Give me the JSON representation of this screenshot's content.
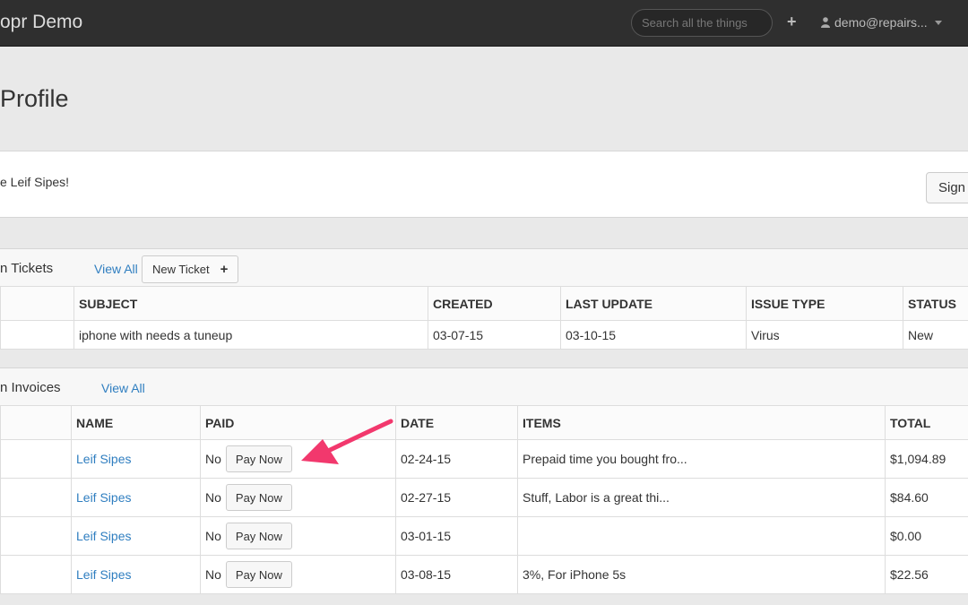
{
  "nav": {
    "brand": "opr Demo",
    "search_placeholder": "Search all the things",
    "add_icon": "plus-icon",
    "user_label": "demo@repairs...",
    "user_icon": "user-icon"
  },
  "page": {
    "title": "Profile",
    "welcome": "e Leif Sipes!",
    "sign_button": "Sign"
  },
  "tickets": {
    "title": "n Tickets",
    "view_all": "View All",
    "new_ticket": "New Ticket",
    "new_ticket_icon": "plus-icon",
    "columns": [
      "SUBJECT",
      "CREATED",
      "LAST UPDATE",
      "ISSUE TYPE",
      "STATUS"
    ],
    "rows": [
      {
        "subject": "iphone with needs a tuneup",
        "created": "03-07-15",
        "last_update": "03-10-15",
        "issue_type": "Virus",
        "status": "New"
      }
    ]
  },
  "invoices": {
    "title": "n Invoices",
    "view_all": "View All",
    "columns": [
      "NAME",
      "PAID",
      "DATE",
      "ITEMS",
      "TOTAL"
    ],
    "pay_label": "Pay Now",
    "rows": [
      {
        "name": "Leif Sipes",
        "paid": "No",
        "date": "02-24-15",
        "items": "Prepaid time you bought fro...",
        "total": "$1,094.89"
      },
      {
        "name": "Leif Sipes",
        "paid": "No",
        "date": "02-27-15",
        "items": "Stuff, Labor is a great thi...",
        "total": "$84.60"
      },
      {
        "name": "Leif Sipes",
        "paid": "No",
        "date": "03-01-15",
        "items": "",
        "total": "$0.00"
      },
      {
        "name": "Leif Sipes",
        "paid": "No",
        "date": "03-08-15",
        "items": "3%, For iPhone 5s",
        "total": "$22.56"
      }
    ]
  },
  "colors": {
    "navbar": "#2f2f2f",
    "link": "#2f7ec0",
    "arrow": "#f2386d"
  }
}
